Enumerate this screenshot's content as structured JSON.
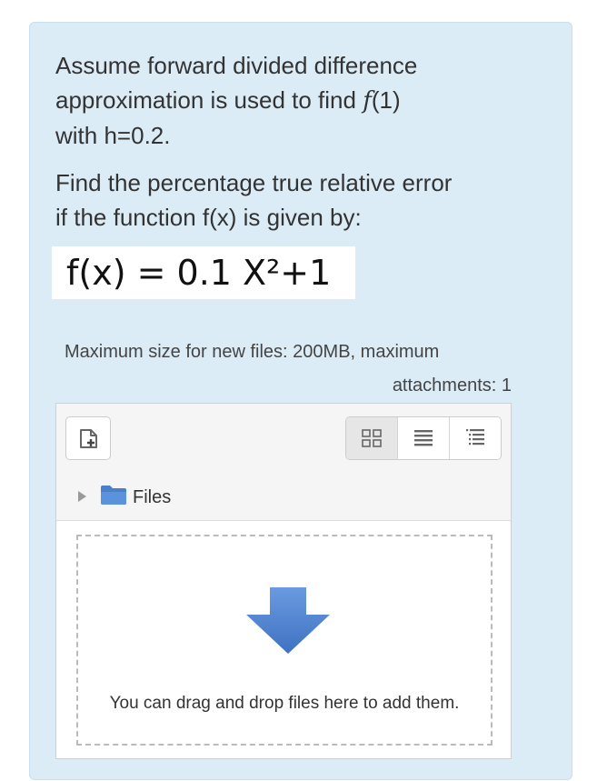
{
  "question": {
    "paragraph1_line1": "Assume forward divided difference",
    "paragraph1_line2_pre": "approximation is used to find ",
    "paragraph1_line2_func": "f",
    "paragraph1_line2_post": "(1)",
    "paragraph1_line3": "with h=0.2.",
    "paragraph2_line1": "Find the percentage true relative error",
    "paragraph2_line2": "if the function f(x) is given by:",
    "formula": "f(x) = 0.1 X²+1"
  },
  "upload_limits": {
    "line1": "Maximum size for new files: 200MB, maximum",
    "line2": "attachments: 1"
  },
  "filemanager": {
    "path_label": "Files",
    "drop_text": "You can drag and drop files here to add them.",
    "icons": {
      "add": "add-file-icon",
      "view_icons": "grid-view-icon",
      "view_list": "list-view-icon",
      "view_tree": "tree-view-icon",
      "folder": "folder-icon",
      "expand": "expand-triangle-icon",
      "drop": "download-arrow-icon"
    },
    "colors": {
      "card_background": "#dcecf6",
      "arrow": "#4a7fc9",
      "folder": "#4a7fc9"
    }
  }
}
